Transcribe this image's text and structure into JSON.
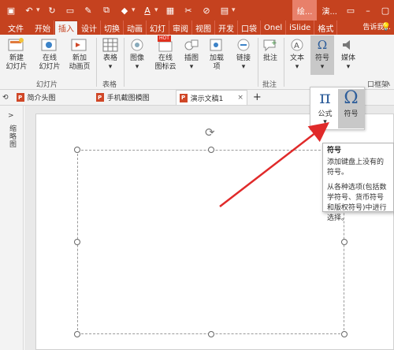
{
  "titlebar": {
    "title_left": "绘...",
    "title_right": "演...",
    "colors": {
      "accent": "#c5421f",
      "ribbon_bg": "#f3f3f3"
    }
  },
  "ribbon_tabs": [
    "文件",
    "开始",
    "插入",
    "设计",
    "切换",
    "动画",
    "幻灯",
    "审阅",
    "视图",
    "开发",
    "口袋",
    "Onel",
    "iSlide",
    "格式"
  ],
  "active_tab": "插入",
  "ribbon": {
    "buttons": {
      "new_slide": "新建\n幻灯片",
      "online_slide": "在线\n幻灯片",
      "new_anim": "新加\n动画页",
      "table": "表格",
      "image": "图像",
      "online_icon": "在线\n图标云",
      "illustration": "插图",
      "addin": "加载\n项",
      "link": "链接",
      "comment": "批注",
      "text": "文本",
      "symbol": "符号",
      "media": "媒体"
    },
    "hot_badge": "HOT",
    "groups": {
      "slides": "幻灯片",
      "tables": "表格",
      "comments": "批注",
      "partial": "口框架"
    },
    "tell_me": "告诉我..."
  },
  "doc_tabs": [
    {
      "label": "简介头图",
      "active": false
    },
    {
      "label": "手机截图模图",
      "active": false
    },
    {
      "label": "演示文稿1",
      "active": true
    }
  ],
  "doc_tab_add": "+",
  "doc_tab_close": "×",
  "left_pane": {
    "label": "缩略图",
    "arrow": ">"
  },
  "symbol_dropdown": {
    "equation_label": "公式",
    "symbol_label": "符号",
    "equation_glyph": "π",
    "symbol_glyph": "Ω"
  },
  "tooltip": {
    "title": "符号",
    "line1": "添加键盘上没有的符号。",
    "line2": "从各种选项(包括数学符号、货币符号和版权符号)中进行选择。"
  }
}
